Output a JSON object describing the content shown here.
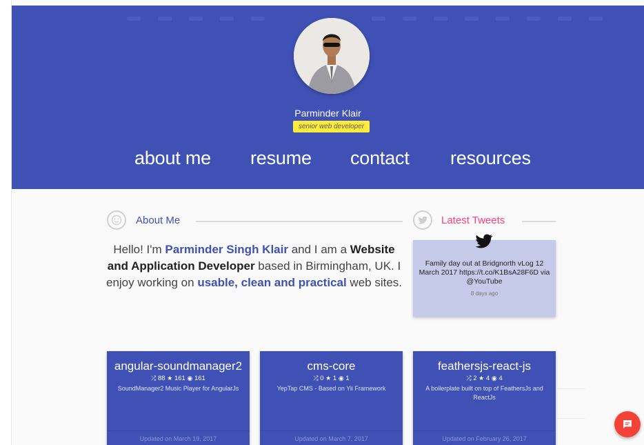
{
  "profile": {
    "name": "Parminder Klair",
    "role": "senior web developer"
  },
  "nav": [
    "about me",
    "resume",
    "contact",
    "resources"
  ],
  "about": {
    "title": "About Me",
    "intro": "Hello! I'm ",
    "name": "Parminder Singh Klair",
    "mid": " and I am a ",
    "profession": "Website and Application Developer",
    "location": " based in Birmingham, UK. I enjoy working on ",
    "qualities": "usable, clean and practical",
    "end": " web sites."
  },
  "tweets": {
    "title": "Latest Tweets",
    "text": "Family day out at Bridgnorth vLog 12 March 2017 https://t.co/K1BsA28F6D via @YouTube",
    "time": "8 days ago"
  },
  "repos": [
    {
      "name": "angular-soundmanager2",
      "forks": "88",
      "stars": "161",
      "watchers": "161",
      "description": "SoundManager2 Music Player for AngularJs",
      "updated": "Updated on March 19, 2017"
    },
    {
      "name": "cms-core",
      "forks": "0",
      "stars": "1",
      "watchers": "1",
      "description": "YepTap CMS - Based on Yii Framework",
      "updated": "Updated on March 7, 2017"
    },
    {
      "name": "feathersjs-react-js",
      "forks": "2",
      "stars": "4",
      "watchers": "4",
      "description": "A boilerplate built on top of FeathersJs and ReactJs",
      "updated": "Updated on February 26, 2017"
    }
  ],
  "colors": {
    "primary": "#3f51b5",
    "accent": "#ff4081",
    "tag": "#ffeb3b",
    "tweet_card": "#c5cae9",
    "chat": "#f44336"
  },
  "icons": {
    "about": "smiley-icon",
    "tweets": "twitter-icon",
    "fork": "fork-icon",
    "star": "star-icon",
    "watch": "eye-icon",
    "chat": "chat-icon"
  }
}
